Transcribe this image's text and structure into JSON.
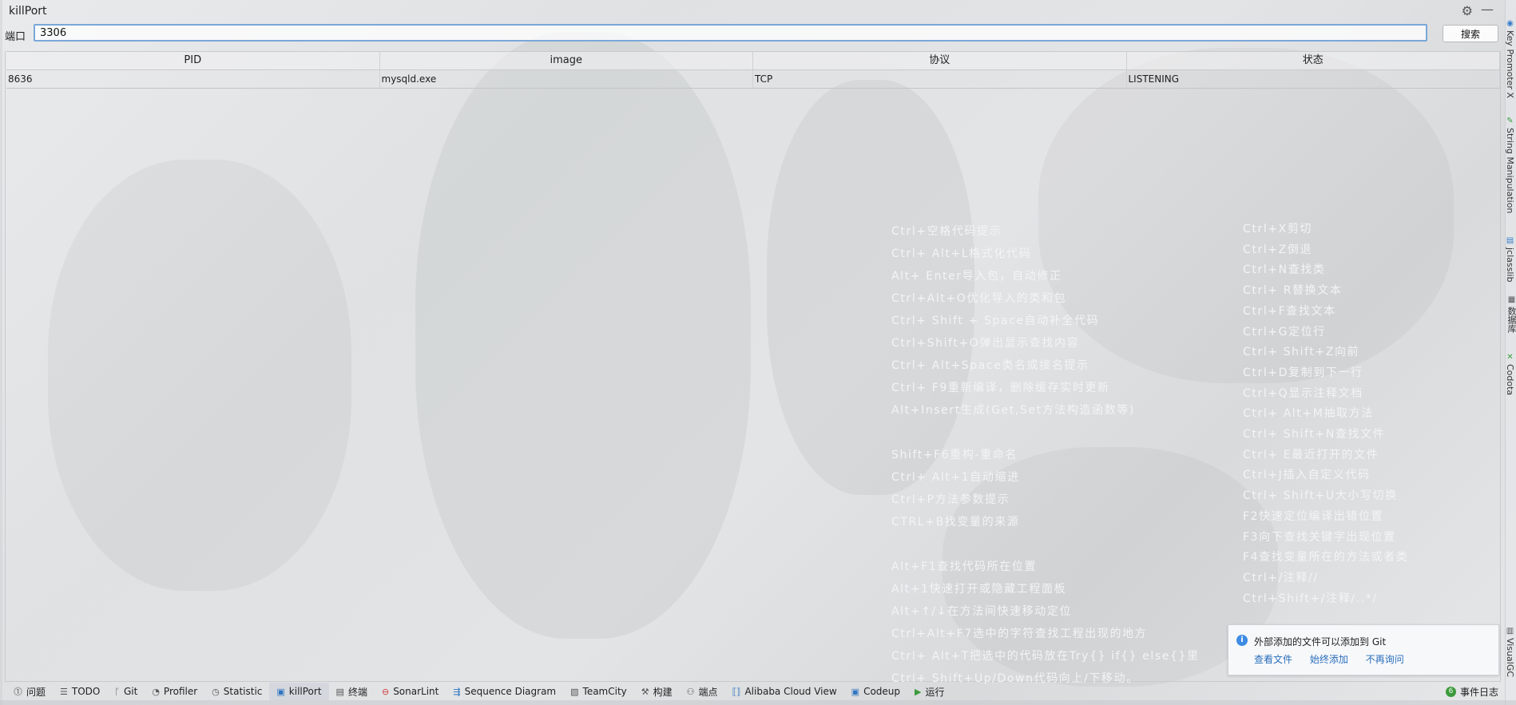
{
  "window": {
    "title": "killPort"
  },
  "search": {
    "label": "端口",
    "value": "3306",
    "button": "搜索"
  },
  "table": {
    "headers": [
      "PID",
      "image",
      "协议",
      "状态"
    ],
    "rows": [
      [
        "8636",
        "mysqld.exe",
        "TCP",
        "LISTENING"
      ]
    ]
  },
  "shortcuts": {
    "left": [
      "Ctrl+空格代码提示",
      "Ctrl+ Alt+L格式化代码",
      "Alt+ Enter导入包，自动修正",
      "Ctrl+Alt+O优化导入的类和包",
      "Ctrl+ Shift + Space自动补全代码",
      "Ctrl+Shift+O弹出显示查找内容",
      "Ctrl+ Alt+Space类名或接名提示",
      "Ctrl+ F9重新编译，删除缓存实时更新",
      "Alt+Insert生成(Get,Set方法构造函数等)",
      "",
      "Shift+F6重构-重命名",
      "Ctrl+ Alt+1自动缩进",
      "Ctrl+P方法参数提示",
      "CTRL+B找变量的来源",
      "",
      "Alt+F1查找代码所在位置",
      "Alt+1快速打开或隐藏工程面板",
      "Alt+↑/↓在方法间快速移动定位",
      "Ctrl+Alt+F7选中的字符查找工程出现的地方",
      "Ctrl+ Alt+T把选中的代码放在Try{} if{} else{}里",
      "Ctrl+ Shift+Up/Down代码向上/下移动。"
    ],
    "right": [
      "Ctrl+X剪切",
      "Ctrl+Z倒退",
      "Ctrl+N查找类",
      "Ctrl+ R替换文本",
      "Ctrl+F查找文本",
      "Ctrl+G定位行",
      "Ctrl+ Shift+Z向前",
      "Ctrl+D复制到下一行",
      "Ctrl+Q显示注释文档",
      "Ctrl+ Alt+M抽取方法",
      "Ctrl+ Shift+N查找文件",
      "Ctrl+ E最近打开的文件",
      "Ctrl+J插入自定义代码",
      "Ctrl+ Shift+U大小写切换",
      "F2快速定位编译出错位置",
      "F3向下查找关键字出现位置",
      "F4查找变量所在的方法或者类",
      "Ctrl+/注释//",
      "Ctrl+Shift+/注释/..*/"
    ]
  },
  "right_tools": [
    "Key Promoter X",
    "String Manipulation",
    "jclasslib",
    "数据库",
    "Codota",
    "VisualGC"
  ],
  "notification": {
    "message": "外部添加的文件可以添加到 Git",
    "actions": [
      "查看文件",
      "始终添加",
      "不再询问"
    ]
  },
  "bottom_tools": [
    {
      "label": "问题",
      "icon": "problems-icon"
    },
    {
      "label": "TODO",
      "icon": "todo-icon"
    },
    {
      "label": "Git",
      "icon": "git-icon"
    },
    {
      "label": "Profiler",
      "icon": "profiler-icon"
    },
    {
      "label": "Statistic",
      "icon": "statistic-icon"
    },
    {
      "label": "killPort",
      "icon": "killport-icon",
      "active": true
    },
    {
      "label": "终端",
      "icon": "terminal-icon"
    },
    {
      "label": "SonarLint",
      "icon": "sonarlint-icon"
    },
    {
      "label": "Sequence Diagram",
      "icon": "sequence-diagram-icon"
    },
    {
      "label": "TeamCity",
      "icon": "teamcity-icon"
    },
    {
      "label": "构建",
      "icon": "build-icon"
    },
    {
      "label": "端点",
      "icon": "endpoints-icon"
    },
    {
      "label": "Alibaba Cloud View",
      "icon": "alibaba-cloud-icon"
    },
    {
      "label": "Codeup",
      "icon": "codeup-icon"
    },
    {
      "label": "运行",
      "icon": "run-icon"
    }
  ],
  "event_log": {
    "label": "事件日志",
    "count": "6"
  }
}
